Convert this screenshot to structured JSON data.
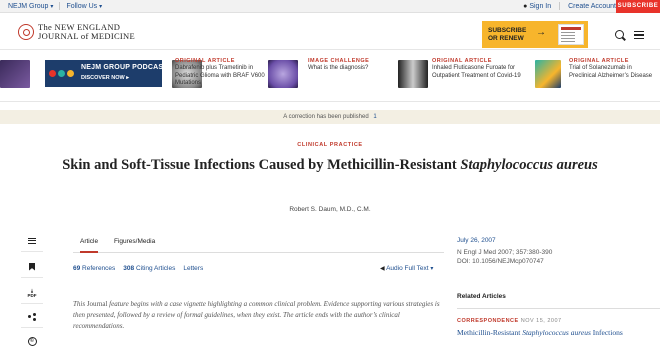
{
  "topbar": {
    "group_label": "NEJM Group",
    "follow_label": "Follow Us",
    "sign_in": "Sign In",
    "create_account": "Create Account",
    "subscribe": "SUBSCRIBE"
  },
  "masthead": {
    "logo_line1": "The NEW ENGLAND",
    "logo_line2": "JOURNAL of MEDICINE",
    "promo_line1": "SUBSCRIBE",
    "promo_line2": "OR RENEW"
  },
  "carousel": {
    "podcast_title": "NEJM GROUP PODCASTS",
    "podcast_cta": "DISCOVER NOW",
    "cards": [
      {
        "kicker": "ORIGINAL ARTICLE",
        "title": "Dabrafenib plus Trametinib in Pediatric Glioma with BRAF V600 Mutations"
      },
      {
        "kicker": "IMAGE CHALLENGE",
        "title": "What is the diagnosis?"
      },
      {
        "kicker": "ORIGINAL ARTICLE",
        "title": "Inhaled Fluticasone Furoate for Outpatient Treatment of Covid-19"
      },
      {
        "kicker": "ORIGINAL ARTICLE",
        "title": "Trial of Solanezumab in Preclinical Alzheimer’s Disease"
      }
    ]
  },
  "correction": {
    "text": "A correction has been published",
    "count": "1"
  },
  "article": {
    "section": "CLINICAL PRACTICE",
    "title_main": "Skin and Soft-Tissue Infections Caused by Methicillin-Resistant ",
    "title_italic": "Staphylococcus aureus",
    "author": "Robert S. Daum, M.D., C.M.",
    "tabs": [
      "Article",
      "Figures/Media"
    ],
    "references_count": "69",
    "references_label": "References",
    "citing_count": "308",
    "citing_label": "Citing Articles",
    "letters_label": "Letters",
    "audio_label": "Audio Full Text",
    "abstract_prefix": "This ",
    "abstract_journal": "Journal",
    "abstract_rest": " feature begins with a case vignette highlighting a common clinical problem. Evidence supporting various strategies is then presented, followed by a review of formal guidelines, when they exist. The article ends with the author’s clinical recommendations."
  },
  "tools": {
    "pdf_label": "PDF",
    "cc_label": "©"
  },
  "sidebar": {
    "pub_date": "July 26, 2007",
    "citation_line1": "N Engl J Med 2007; 357:380-390",
    "citation_line2": "DOI: 10.1056/NEJMcp070747",
    "related_heading": "Related Articles",
    "related_kicker": "CORRESPONDENCE",
    "related_date": "NOV 15, 2007",
    "related_title_plain": "Methicillin-Resistant ",
    "related_title_italic": "Staphylococcus aureus",
    "related_title_end": " Infections"
  }
}
